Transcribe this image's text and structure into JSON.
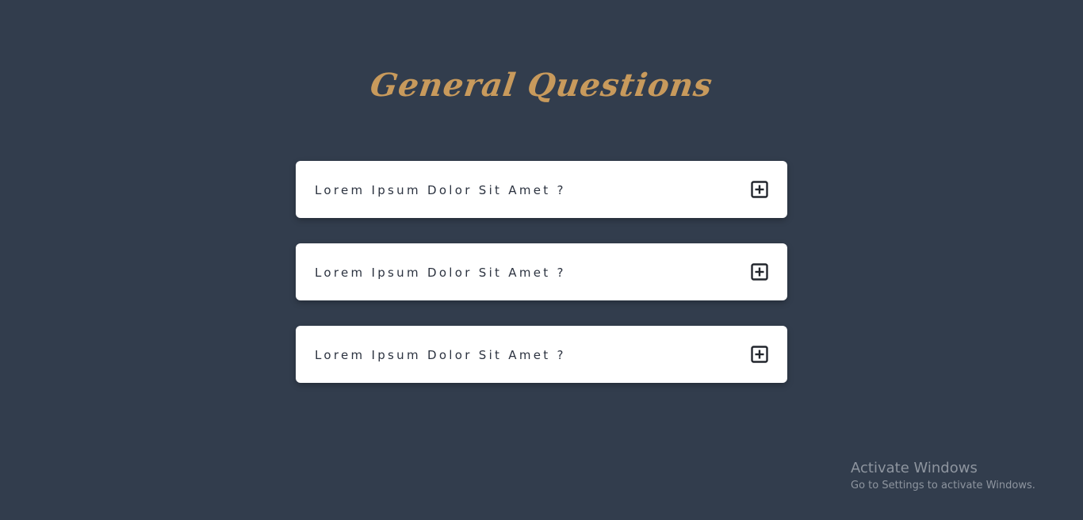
{
  "header": {
    "title": "General Questions"
  },
  "faq": {
    "items": [
      {
        "question": "Lorem Ipsum Dolor Sit Amet ?",
        "toggle_icon": "plus-square-icon"
      },
      {
        "question": "Lorem Ipsum Dolor Sit Amet ?",
        "toggle_icon": "plus-square-icon"
      },
      {
        "question": "Lorem Ipsum Dolor Sit Amet ?",
        "toggle_icon": "plus-square-icon"
      }
    ]
  },
  "watermark": {
    "title": "Activate Windows",
    "subtitle": "Go to Settings to activate Windows."
  },
  "colors": {
    "background": "#323d4d",
    "title": "#c89a5c",
    "card": "#ffffff",
    "question_text": "#2c3340"
  }
}
